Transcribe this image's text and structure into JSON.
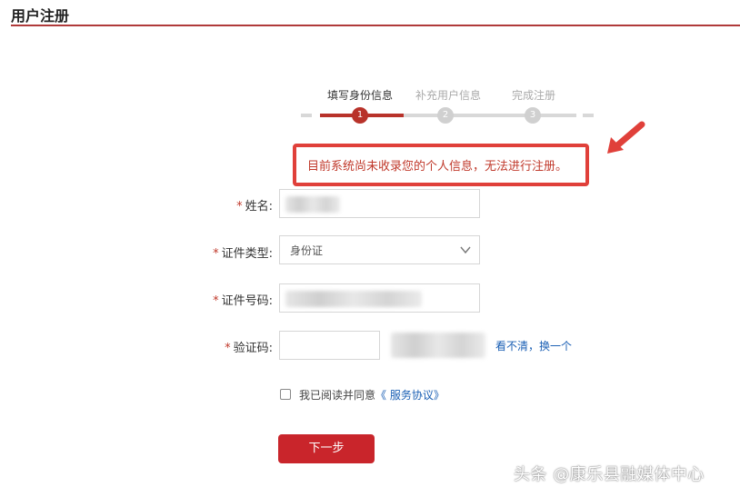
{
  "header": {
    "title": "用户注册"
  },
  "steps": [
    {
      "label": "填写身份信息",
      "number": "1",
      "active": true
    },
    {
      "label": "补充用户信息",
      "number": "2",
      "active": false
    },
    {
      "label": "完成注册",
      "number": "3",
      "active": false
    }
  ],
  "error": {
    "message": "目前系统尚未收录您的个人信息，无法进行注册。"
  },
  "form": {
    "required_mark": "*",
    "name_label": "姓名:",
    "id_type_label": "证件类型:",
    "id_type_value": "身份证",
    "id_number_label": "证件号码:",
    "captcha_label": "验证码:",
    "captcha_refresh": "看不清，换一个",
    "agree_text": "我已阅读并同意",
    "agree_link": "《 服务协议》",
    "next_button": "下一步"
  },
  "watermark": "头条 @康乐县融媒体中心",
  "colors": {
    "accent": "#c9252b",
    "error": "#e0403a",
    "link": "#1a5fb4"
  },
  "icons": {
    "arrow": "red-arrow-icon",
    "select": "chevron-down-icon"
  }
}
